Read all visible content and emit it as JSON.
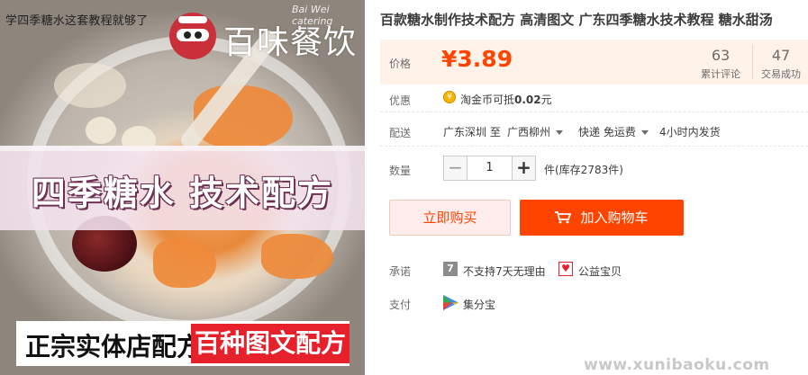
{
  "image": {
    "caption": "学四季糖水这套教程就够了",
    "brand_name": "百味餐饮",
    "brand_sub": "Bai Wei catering",
    "banner_text": "四季糖水 技术配方",
    "bottom_left": "正宗实体店配方",
    "bottom_right": "百种图文配方"
  },
  "product": {
    "title": "百款糖水制作技术配方 高清图文 广东四季糖水技术教程 糖水甜汤",
    "price_label": "价格",
    "currency": "¥",
    "price": "3.89",
    "reviews_count": "63",
    "reviews_label": "累计评论",
    "sales_count": "47",
    "sales_label": "交易成功"
  },
  "promo": {
    "label": "优惠",
    "text_prefix": "淘金币可抵",
    "amount": "0.02",
    "unit": "元"
  },
  "shipping": {
    "label": "配送",
    "from": "广东深圳 至",
    "to": "广西柳州",
    "method": "快递 免运费",
    "dispatch": "4小时内发货"
  },
  "quantity": {
    "label": "数量",
    "minus": "−",
    "plus": "+",
    "value": "1",
    "stock_text": "件(库存2783件)"
  },
  "actions": {
    "buy_now": "立即购买",
    "add_to_cart": "加入购物车"
  },
  "promise": {
    "label": "承诺",
    "no_return_badge": "7",
    "no_return_text": "不支持7天无理由",
    "charity_text": "公益宝贝"
  },
  "payment": {
    "label": "支付",
    "method": "集分宝"
  },
  "watermark": "www.xunibaoku.com",
  "colors": {
    "accent": "#ff4400",
    "price_bg": "#fff2e8",
    "buy_bg": "#ffeded"
  }
}
